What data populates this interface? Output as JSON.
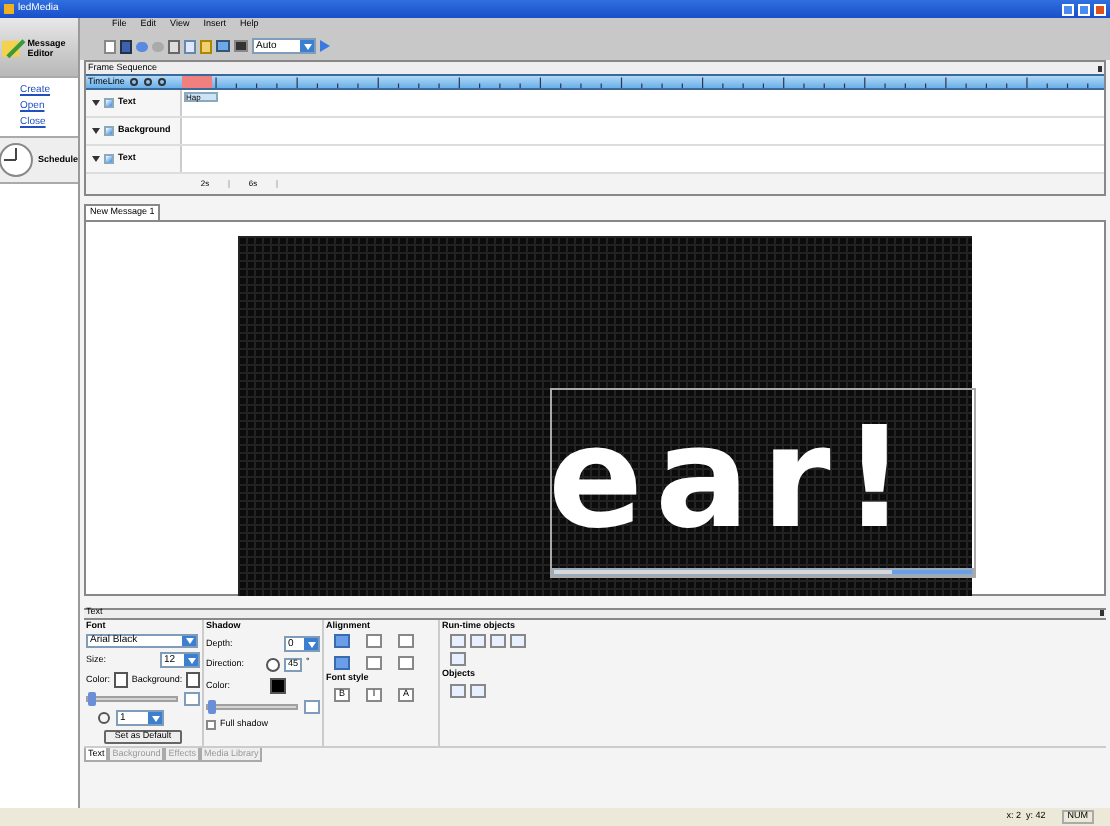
{
  "window": {
    "title": "ledMedia"
  },
  "sidebar": {
    "modules": [
      {
        "label": "Message Editor",
        "kind": "editor",
        "selected": true
      },
      {
        "label": "Schedule",
        "kind": "schedule",
        "selected": false
      }
    ],
    "links": [
      "Create",
      "Open",
      "Close"
    ]
  },
  "menu": [
    "File",
    "Edit",
    "View",
    "Insert",
    "Help"
  ],
  "toolbar": {
    "zoom": "Auto"
  },
  "frame_sequence": {
    "title": "Frame Sequence",
    "timeline_label": "TimeLine",
    "tracks": [
      {
        "name": "Text",
        "clip": "Hap"
      },
      {
        "name": "Background"
      },
      {
        "name": "Text"
      }
    ],
    "durations": [
      "2s",
      "6s"
    ]
  },
  "document_tab": {
    "label": "New Message 1",
    "selected": true
  },
  "display": {
    "text": "ear!"
  },
  "properties": {
    "title": "Text",
    "font": {
      "title": "Font",
      "family": "Arial Black",
      "size_label": "Size:",
      "size": "12",
      "color_label": "Color:",
      "background_label": "Background:",
      "slider": {
        "level": 0
      },
      "spacing": "1",
      "default_button": "Set as Default"
    },
    "shadow": {
      "title": "Shadow",
      "depth_label": "Depth:",
      "depth": "0",
      "direction_label": "Direction:",
      "direction": "45",
      "degree": "°",
      "color_label": "Color:",
      "slider": {
        "level": 0
      },
      "full_shadow": {
        "label": "Full shadow",
        "checked": false
      }
    },
    "alignment": {
      "title": "Alignment",
      "buttons": [
        {
          "selected": true
        },
        {
          "selected": false
        },
        {
          "selected": false
        },
        {
          "selected": true
        },
        {
          "selected": false
        },
        {
          "selected": false
        }
      ]
    },
    "font_style": {
      "title": "Font style",
      "buttons": [
        {
          "label": "B",
          "selected": false
        },
        {
          "label": "I",
          "selected": false
        },
        {
          "label": "A",
          "selected": false
        }
      ]
    },
    "runtime_objects": {
      "title": "Run-time objects"
    },
    "objects": {
      "title": "Objects"
    },
    "tabs": [
      {
        "label": "Text",
        "selected": true
      },
      {
        "label": "Background",
        "selected": false
      },
      {
        "label": "Effects",
        "selected": false
      },
      {
        "label": "Media Library",
        "selected": false
      }
    ]
  },
  "status_bar": {
    "position": "x: 2  y: 42",
    "num": "NUM"
  }
}
